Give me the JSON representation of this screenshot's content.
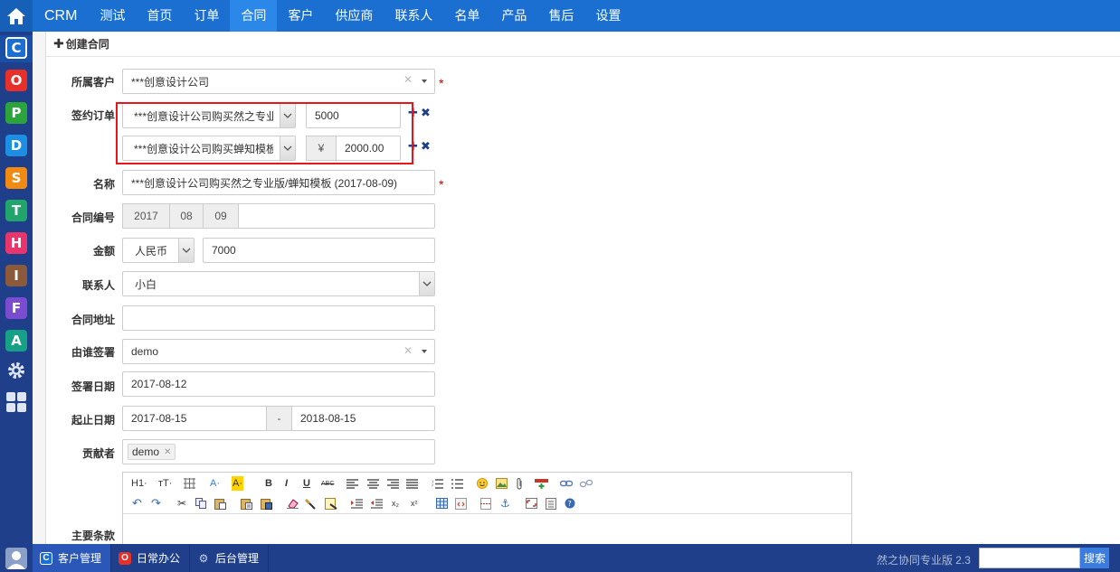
{
  "nav": {
    "brand": "CRM",
    "items": [
      "测试",
      "首页",
      "订单",
      "合同",
      "客户",
      "供应商",
      "联系人",
      "名单",
      "产品",
      "售后",
      "设置"
    ],
    "active": "合同"
  },
  "sidebar": {
    "apps": [
      {
        "letter": "C",
        "color": "#1a6fd0"
      },
      {
        "letter": "O",
        "color": "#e8302a"
      },
      {
        "letter": "P",
        "color": "#2aa43b"
      },
      {
        "letter": "D",
        "color": "#1c8fe2"
      },
      {
        "letter": "S",
        "color": "#f08a12"
      },
      {
        "letter": "T",
        "color": "#22a56a"
      },
      {
        "letter": "H",
        "color": "#e8356b"
      },
      {
        "letter": "I",
        "color": "#8a5a3a"
      },
      {
        "letter": "F",
        "color": "#7b4bd0"
      },
      {
        "letter": "A",
        "color": "#16a085"
      }
    ]
  },
  "panel": {
    "title": "创建合同"
  },
  "form": {
    "customer": {
      "label": "所属客户",
      "value": "***创意设计公司"
    },
    "orders": {
      "label": "签约订单",
      "rows": [
        {
          "order": "***创意设计公司购买然之专业",
          "amount": "5000",
          "currency": ""
        },
        {
          "order": "***创意设计公司购买蝉知模板",
          "amount": "2000.00",
          "currency": "¥"
        }
      ]
    },
    "name": {
      "label": "名称",
      "value": "***创意设计公司购买然之专业版/蝉知模板 (2017-08-09)"
    },
    "code": {
      "label": "合同编号",
      "parts": [
        "2017",
        "08",
        "09"
      ],
      "value": ""
    },
    "amount": {
      "label": "金额",
      "currency": "人民币",
      "value": "7000"
    },
    "contact": {
      "label": "联系人",
      "value": "小白"
    },
    "address": {
      "label": "合同地址",
      "value": ""
    },
    "signer": {
      "label": "由谁签署",
      "value": "demo"
    },
    "sign_date": {
      "label": "签署日期",
      "value": "2017-08-12"
    },
    "period": {
      "label": "起止日期",
      "start": "2017-08-15",
      "sep": "-",
      "end": "2018-08-15"
    },
    "contributor": {
      "label": "贡献者",
      "tag": "demo"
    },
    "terms": {
      "label": "主要条款"
    }
  },
  "editor": {
    "row1": [
      "H1",
      "TT",
      "A",
      "A",
      "B",
      "I",
      "U",
      "ABC"
    ],
    "row1_labels": {
      "h1": "H1·",
      "size": "тT·",
      "color": "A·",
      "bg": "A·",
      "bold": "B",
      "italic": "I",
      "underline": "U",
      "strike": "ABC"
    }
  },
  "bottombar": {
    "tabs": [
      {
        "label": "客户管理",
        "letter": "C",
        "color": "#1a6fd0"
      },
      {
        "label": "日常办公",
        "letter": "O",
        "color": "#e8302a"
      },
      {
        "label": "后台管理",
        "letter": "⚙",
        "color": "transparent"
      }
    ],
    "version": "然之协同专业版 2.3",
    "search_button": "搜索",
    "search_value": ""
  }
}
